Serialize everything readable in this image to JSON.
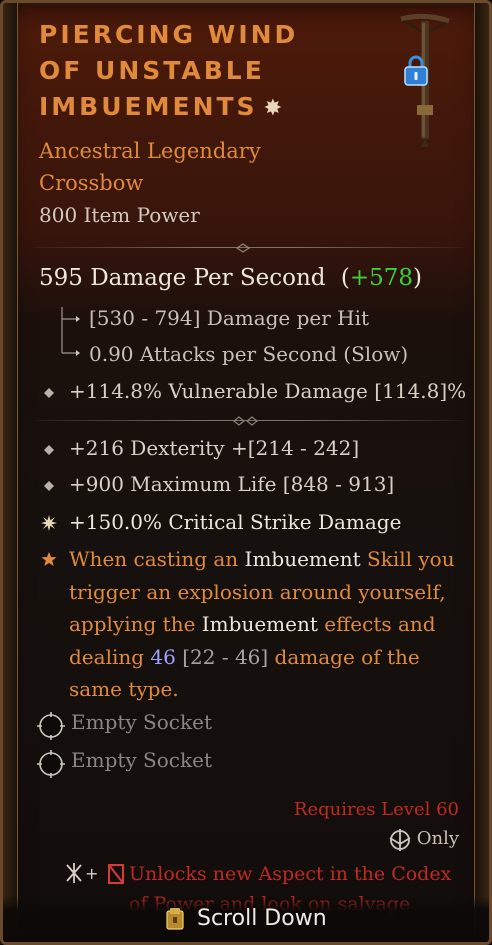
{
  "item": {
    "title_lines": [
      "Piercing Wind",
      "of Unstable",
      "Imbuements"
    ],
    "rarity_line1": "Ancestral Legendary",
    "rarity_line2": "Crossbow",
    "item_power": "800 Item Power"
  },
  "primary": {
    "dps": "595 Damage Per Second",
    "dps_delta": "+578",
    "damage_per_hit": "[530 - 794] Damage per Hit",
    "attack_speed": "0.90 Attacks per Second (Slow)",
    "implicit": "+114.8% Vulnerable Damage [114.8]%"
  },
  "affixes": [
    {
      "text": "+216 Dexterity +[214 - 242]",
      "icon": "diamond-bullet-icon"
    },
    {
      "text": "+900 Maximum Life [848 - 913]",
      "icon": "diamond-bullet-icon"
    },
    {
      "text": "+150.0% Critical Strike Damage",
      "icon": "greater-affix-star-icon"
    }
  ],
  "legendary_power": {
    "icon": "legendary-star-icon",
    "seg1": "When casting an ",
    "seg2": "Imbuement",
    "seg3": " Skill you trigger an explosion around yourself, applying the ",
    "seg4": "Imbuement",
    "seg5": " effects and dealing ",
    "seg6": "46",
    "seg7": " [22 - 46]",
    "seg8": " damage of the same type."
  },
  "sockets": [
    "Empty Socket",
    "Empty Socket"
  ],
  "requirements": {
    "level": "Requires Level 60",
    "class_only": "Only",
    "class_icon": "rogue-class-icon"
  },
  "aspect": {
    "plus": "+",
    "text": "Unlocks new Aspect in the Codex of Power and look on salvage"
  },
  "scroll": {
    "label": "Scroll Down",
    "icon": "scroll-chest-icon"
  },
  "colors": {
    "legendary_orange": "#e08a3c",
    "increase_green": "#3fcf3b",
    "requirement_red": "#c02a22",
    "number_blue": "#9ea0ff",
    "lock_blue": "#3a8fe0"
  }
}
